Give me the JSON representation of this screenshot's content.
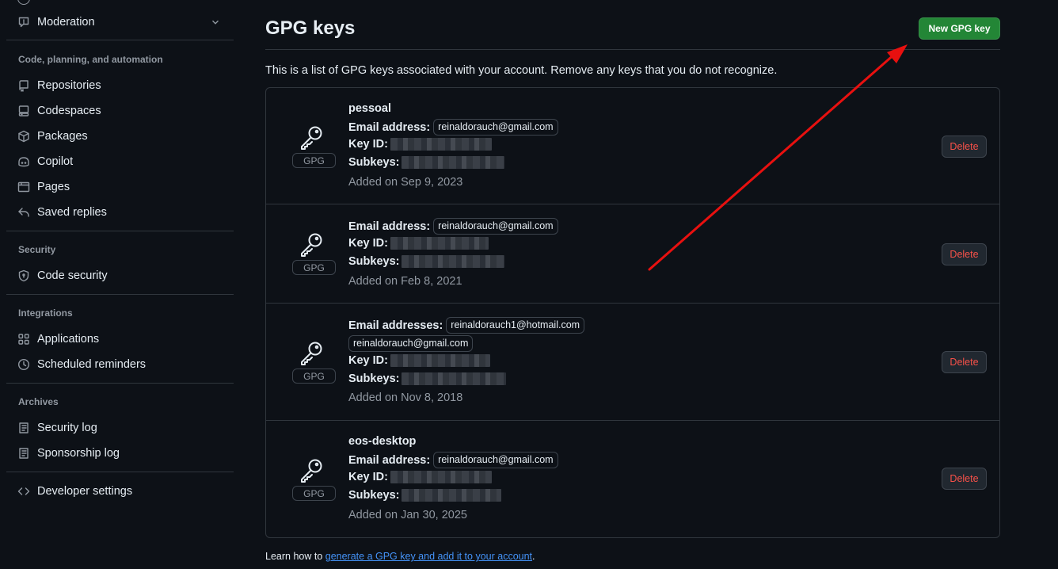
{
  "sidebar": {
    "top_item": {
      "label": "Moderation",
      "icon": "report-icon"
    },
    "sections": [
      {
        "heading": "Code, planning, and automation",
        "items": [
          {
            "label": "Repositories",
            "icon": "repo-icon"
          },
          {
            "label": "Codespaces",
            "icon": "codespaces-icon"
          },
          {
            "label": "Packages",
            "icon": "package-icon"
          },
          {
            "label": "Copilot",
            "icon": "copilot-icon"
          },
          {
            "label": "Pages",
            "icon": "browser-icon"
          },
          {
            "label": "Saved replies",
            "icon": "reply-icon"
          }
        ]
      },
      {
        "heading": "Security",
        "items": [
          {
            "label": "Code security",
            "icon": "shield-icon"
          }
        ]
      },
      {
        "heading": "Integrations",
        "items": [
          {
            "label": "Applications",
            "icon": "apps-icon"
          },
          {
            "label": "Scheduled reminders",
            "icon": "clock-icon"
          }
        ]
      },
      {
        "heading": "Archives",
        "items": [
          {
            "label": "Security log",
            "icon": "log-icon"
          },
          {
            "label": "Sponsorship log",
            "icon": "log-icon"
          }
        ]
      }
    ],
    "developer_settings": {
      "label": "Developer settings",
      "icon": "code-icon"
    }
  },
  "main": {
    "title": "GPG keys",
    "new_button": "New GPG key",
    "intro": "This is a list of GPG keys associated with your account. Remove any keys that you do not recognize.",
    "key_badge": "GPG",
    "delete_label": "Delete",
    "keys": [
      {
        "name": "pessoal",
        "email_label": "Email address:",
        "emails": [
          "reinaldorauch@gmail.com"
        ],
        "key_id_label": "Key ID:",
        "subkeys_label": "Subkeys:",
        "added": "Added on Sep 9, 2023"
      },
      {
        "name": "",
        "email_label": "Email address:",
        "emails": [
          "reinaldorauch@gmail.com"
        ],
        "key_id_label": "Key ID:",
        "subkeys_label": "Subkeys:",
        "added": "Added on Feb 8, 2021"
      },
      {
        "name": "",
        "email_label": "Email addresses:",
        "emails": [
          "reinaldorauch1@hotmail.com",
          "reinaldorauch@gmail.com"
        ],
        "key_id_label": "Key ID:",
        "subkeys_label": "Subkeys:",
        "added": "Added on Nov 8, 2018"
      },
      {
        "name": "eos-desktop",
        "email_label": "Email address:",
        "emails": [
          "reinaldorauch@gmail.com"
        ],
        "key_id_label": "Key ID:",
        "subkeys_label": "Subkeys:",
        "added": "Added on Jan 30, 2025"
      }
    ],
    "footer_prefix": "Learn how to ",
    "footer_link": "generate a GPG key and add it to your account",
    "footer_suffix": "."
  },
  "colors": {
    "background": "#0d1117",
    "primary_button": "#238636",
    "danger_text": "#f85149",
    "link": "#4493f8",
    "annotation_arrow": "#e8100f"
  }
}
